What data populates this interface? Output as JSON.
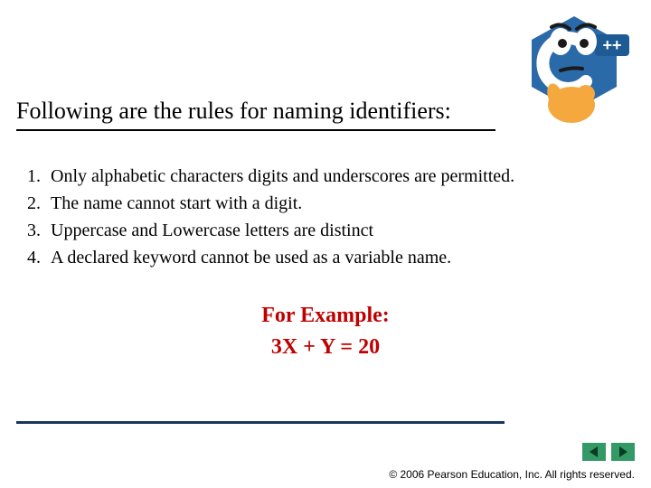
{
  "heading": "Following are the rules for naming identifiers:",
  "rules": [
    "Only alphabetic characters digits and underscores are permitted.",
    "The name cannot start with a digit.",
    "Uppercase and Lowercase letters are distinct",
    "A declared keyword cannot be used as a variable name."
  ],
  "example": {
    "title": "For Example:",
    "equation": "3X + Y = 20"
  },
  "footer": "© 2006 Pearson Education, Inc.  All rights reserved.",
  "logo": {
    "badge": "++"
  }
}
